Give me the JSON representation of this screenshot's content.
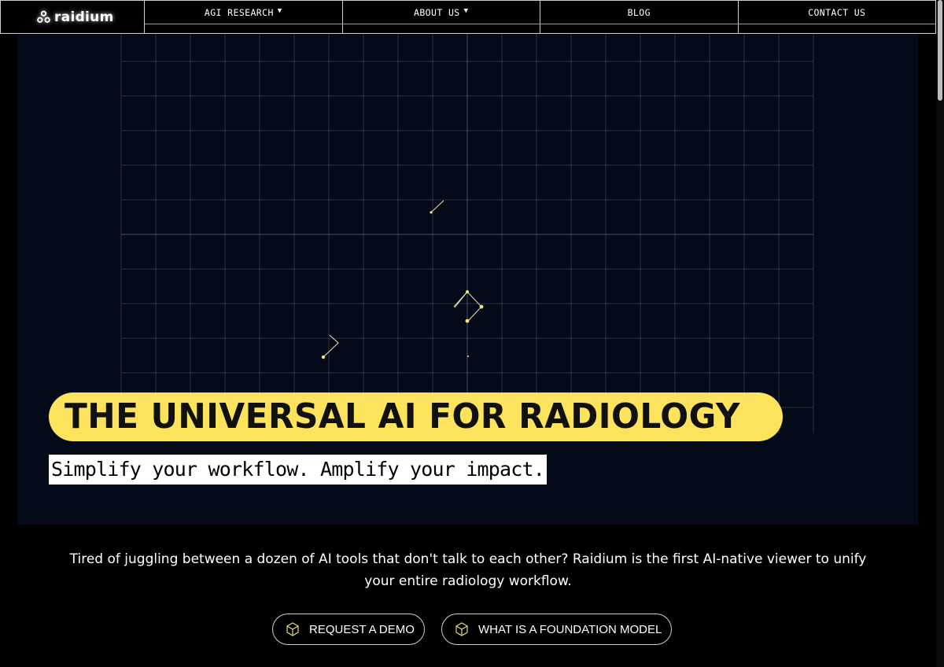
{
  "brand": {
    "name": "raidium",
    "icon": "raidium-logo-icon"
  },
  "nav": {
    "items": [
      {
        "label": "AGI RESEARCH",
        "has_dropdown": true
      },
      {
        "label": "ABOUT US",
        "has_dropdown": true
      },
      {
        "label": "BLOG",
        "has_dropdown": false
      },
      {
        "label": "CONTACT US",
        "has_dropdown": false
      }
    ],
    "dropdown_glyph": "▼"
  },
  "hero": {
    "title": "THE UNIVERSAL AI FOR RADIOLOGY",
    "subtitle": "Simplify your workflow. Amplify your impact."
  },
  "intro": {
    "text": "Tired of juggling between a dozen of AI tools that don't talk to each other? Raidium is the first AI-native viewer to unify your entire radiology workflow."
  },
  "cta": {
    "primary": {
      "label": "REQUEST A DEMO",
      "icon": "cube-icon"
    },
    "secondary": {
      "label": "WHAT IS A FOUNDATION MODEL",
      "icon": "cube-icon"
    }
  },
  "colors": {
    "accent_yellow": "#fce35c",
    "hero_bg": "#050a19",
    "page_bg": "#000000",
    "grid_line": "#2a3346"
  }
}
